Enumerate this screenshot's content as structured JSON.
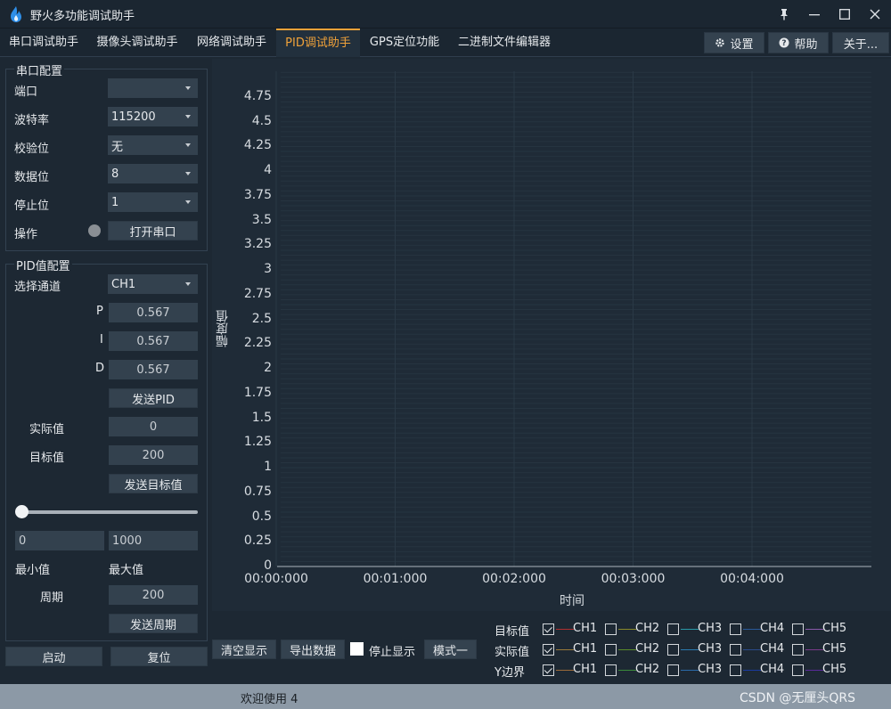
{
  "window": {
    "title": "野火多功能调试助手"
  },
  "tabs": [
    {
      "label": "串口调试助手"
    },
    {
      "label": "摄像头调试助手"
    },
    {
      "label": "网络调试助手"
    },
    {
      "label": "PID调试助手"
    },
    {
      "label": "GPS定位功能"
    },
    {
      "label": "二进制文件编辑器"
    }
  ],
  "topbuttons": {
    "settings": "设置",
    "help": "帮助",
    "about": "关于..."
  },
  "serial": {
    "title": "串口配置",
    "port_label": "端口",
    "port_value": "",
    "baud_label": "波特率",
    "baud_value": "115200",
    "parity_label": "校验位",
    "parity_value": "无",
    "databits_label": "数据位",
    "databits_value": "8",
    "stopbits_label": "停止位",
    "stopbits_value": "1",
    "op_label": "操作",
    "open_button": "打开串口",
    "status_color": "#8a8f94"
  },
  "pid": {
    "title": "PID值配置",
    "channel_label": "选择通道",
    "channel_value": "CH1",
    "p_label": "P",
    "p_value": "0.567",
    "i_label": "I",
    "i_value": "0.567",
    "d_label": "D",
    "d_value": "0.567",
    "send_pid": "发送PID",
    "actual_label": "实际值",
    "actual_value": "0",
    "target_label": "目标值",
    "target_value": "200",
    "send_target": "发送目标值",
    "slider_min": "0",
    "slider_max": "1000",
    "slider_level": 0,
    "min_label": "最小值",
    "max_label": "最大值",
    "period_label": "周期",
    "period_value": "200",
    "send_period": "发送周期"
  },
  "bottom_left": {
    "start": "启动",
    "reset": "复位"
  },
  "plot": {
    "ylabel": "幅度值",
    "xlabel": "时间",
    "yticks": [
      "4.75",
      "4.5",
      "4.25",
      "4",
      "3.75",
      "3.5",
      "3.25",
      "3",
      "2.75",
      "2.5",
      "2.25",
      "2",
      "1.75",
      "1.5",
      "1.25",
      "1",
      "0.75",
      "0.5",
      "0.25",
      "0"
    ],
    "xticks": [
      "00:00:000",
      "00:01:000",
      "00:02:000",
      "00:03:000",
      "00:04:000"
    ]
  },
  "controls": {
    "clear": "清空显示",
    "export": "导出数据",
    "stop_label": "停止显示",
    "mode": "模式一"
  },
  "legend": {
    "rows": [
      {
        "label": "目标值",
        "items": [
          {
            "ch": "CH1",
            "checked": true,
            "color": "#b03030"
          },
          {
            "ch": "CH2",
            "checked": false,
            "color": "#8a8a2a"
          },
          {
            "ch": "CH3",
            "checked": false,
            "color": "#2a9aa8"
          },
          {
            "ch": "CH4",
            "checked": false,
            "color": "#2a5a9a"
          },
          {
            "ch": "CH5",
            "checked": false,
            "color": "#8a5aaa"
          }
        ]
      },
      {
        "label": "实际值",
        "items": [
          {
            "ch": "CH1",
            "checked": true,
            "color": "#9a7a3a"
          },
          {
            "ch": "CH2",
            "checked": false,
            "color": "#5a8a2a"
          },
          {
            "ch": "CH3",
            "checked": false,
            "color": "#2a7ab0"
          },
          {
            "ch": "CH4",
            "checked": false,
            "color": "#2a4a8a"
          },
          {
            "ch": "CH5",
            "checked": false,
            "color": "#7a3a8a"
          }
        ]
      },
      {
        "label": "Y边界",
        "items": [
          {
            "ch": "CH1",
            "checked": true,
            "color": "#9a6a3a"
          },
          {
            "ch": "CH2",
            "checked": false,
            "color": "#3a8a3a"
          },
          {
            "ch": "CH3",
            "checked": false,
            "color": "#2a6aa8"
          },
          {
            "ch": "CH4",
            "checked": false,
            "color": "#1a3aa0"
          },
          {
            "ch": "CH5",
            "checked": false,
            "color": "#5a2a9a"
          }
        ]
      }
    ]
  },
  "status": {
    "message": "欢迎使用 4",
    "watermark": "CSDN @无厘头QRS"
  }
}
